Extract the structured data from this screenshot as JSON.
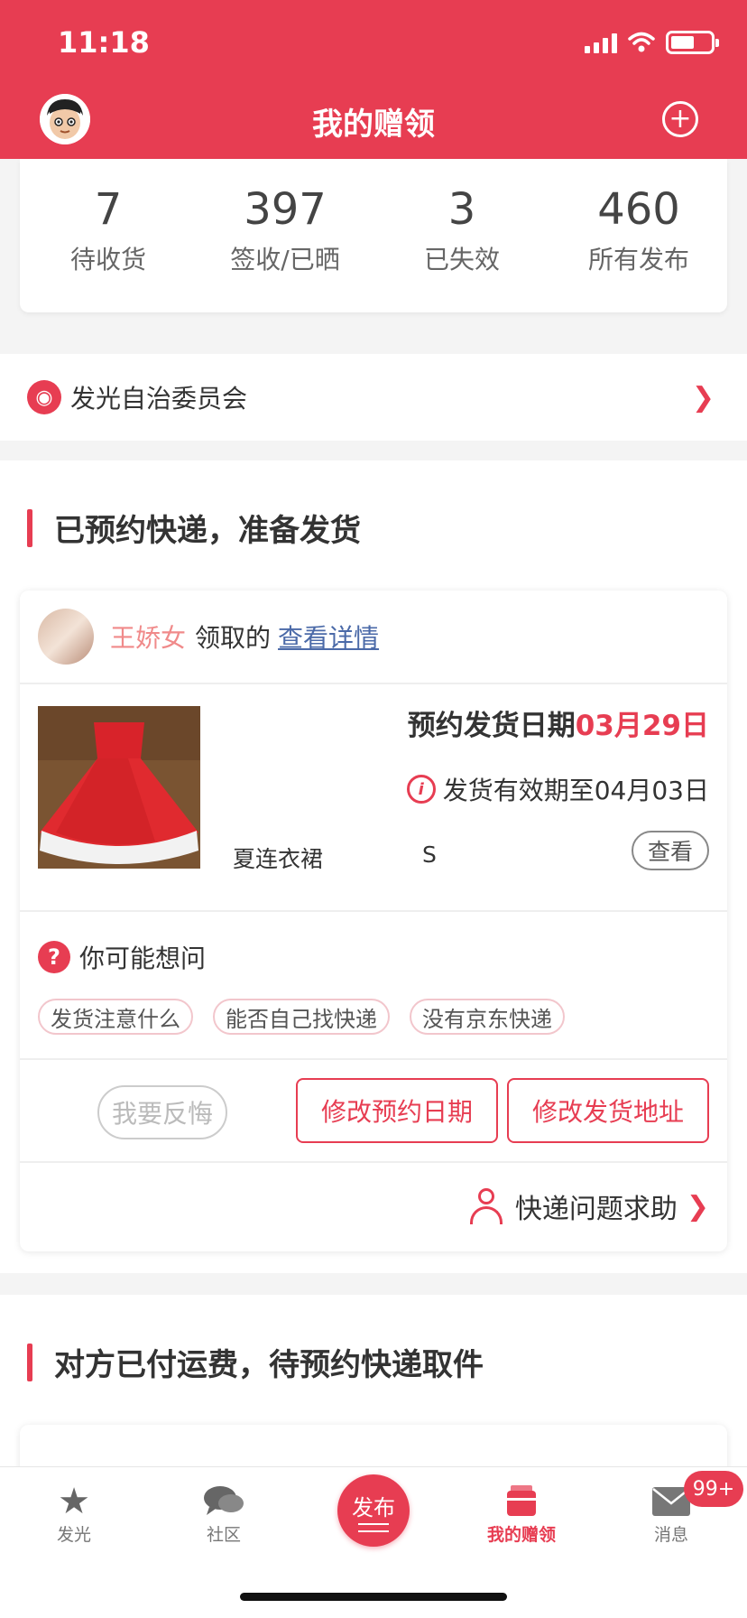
{
  "status": {
    "time": "11:18"
  },
  "header": {
    "title": "我的赠领",
    "avatar_icon": "avatar-icon",
    "add_icon": "plus-circle-icon"
  },
  "stats": [
    {
      "value": "7",
      "label": "待收货"
    },
    {
      "value": "397",
      "label": "签收/已晒"
    },
    {
      "value": "3",
      "label": "已失效"
    },
    {
      "value": "460",
      "label": "所有发布"
    }
  ],
  "committee": {
    "label": "发光自治委员会"
  },
  "section_a": {
    "title": "已预约快递，准备发货"
  },
  "order": {
    "user_name": "王娇女",
    "claimed_text": "领取的",
    "detail_link": "查看详情",
    "date_label": "预约发货日期",
    "date_value": "03月29日",
    "validity_text": "发货有效期至04月03日",
    "product_name": "夏连衣裙",
    "size": "S",
    "view_label": "查看",
    "faq_title": "你可能想问",
    "faq_tags": [
      "发货注意什么",
      "能否自己找快递",
      "没有京东快递"
    ],
    "regret_label": "我要反悔",
    "change_date_label": "修改预约日期",
    "change_address_label": "修改发货地址",
    "help_label": "快递问题求助"
  },
  "section_b": {
    "title": "对方已付运费，待预约快递取件"
  },
  "tabbar": {
    "items": [
      {
        "label": "发光",
        "icon": "star-icon"
      },
      {
        "label": "社区",
        "icon": "chat-bubbles-icon"
      },
      {
        "label": "发布",
        "icon": "publish-icon"
      },
      {
        "label": "我的赠领",
        "icon": "gift-box-icon"
      },
      {
        "label": "消息",
        "icon": "mail-icon"
      }
    ],
    "message_badge": "99+"
  },
  "colors": {
    "brand": "#e73d52",
    "link": "#4b6aa8"
  }
}
